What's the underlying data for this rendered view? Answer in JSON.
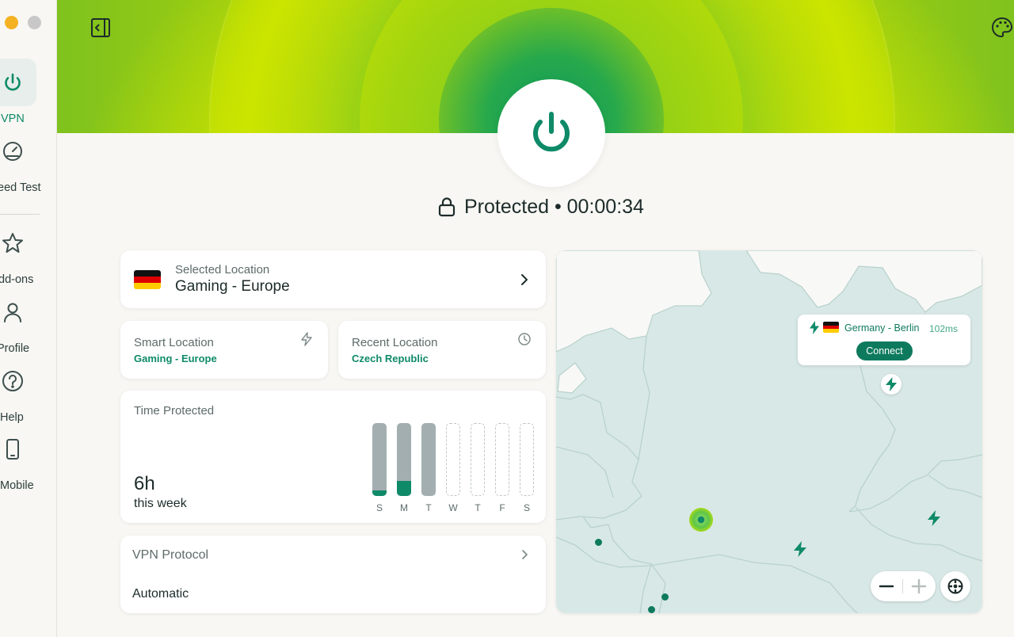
{
  "sidebar": {
    "items": [
      {
        "label": "VPN",
        "icon": "power-icon",
        "active": true
      },
      {
        "label": "eed Test",
        "icon": "speedometer-icon"
      },
      {
        "label": "dd-ons",
        "icon": "star-icon"
      },
      {
        "label": "Profile",
        "icon": "person-icon"
      },
      {
        "label": "Help",
        "icon": "question-icon"
      },
      {
        "label": " Mobile",
        "icon": "phone-icon"
      }
    ]
  },
  "header": {
    "status_text": "Protected • 00:00:34"
  },
  "selected_location": {
    "label": "Selected Location",
    "value": "Gaming - Europe"
  },
  "smart_location": {
    "label": "Smart Location",
    "value": "Gaming - Europe"
  },
  "recent_location": {
    "label": "Recent Location",
    "value": "Czech Republic"
  },
  "time_protected": {
    "label": "Time Protected",
    "hours": "6h",
    "period": "this week",
    "days": [
      {
        "day": "S",
        "recorded": true,
        "fraction": 0.08
      },
      {
        "day": "M",
        "recorded": true,
        "fraction": 0.21
      },
      {
        "day": "T",
        "recorded": true,
        "fraction": 0.0
      },
      {
        "day": "W",
        "recorded": false,
        "fraction": 0
      },
      {
        "day": "T",
        "recorded": false,
        "fraction": 0
      },
      {
        "day": "F",
        "recorded": false,
        "fraction": 0
      },
      {
        "day": "S",
        "recorded": false,
        "fraction": 0
      }
    ]
  },
  "vpn_protocol": {
    "label": "VPN Protocol",
    "value": "Automatic"
  },
  "map": {
    "popup": {
      "location": "Germany - Berlin",
      "ping": "102ms",
      "connect_label": "Connect"
    }
  },
  "colors": {
    "accent": "#0e8a68",
    "lime": "#c9e300",
    "background": "#f8f7f3",
    "map_water": "#d8e8e6"
  }
}
